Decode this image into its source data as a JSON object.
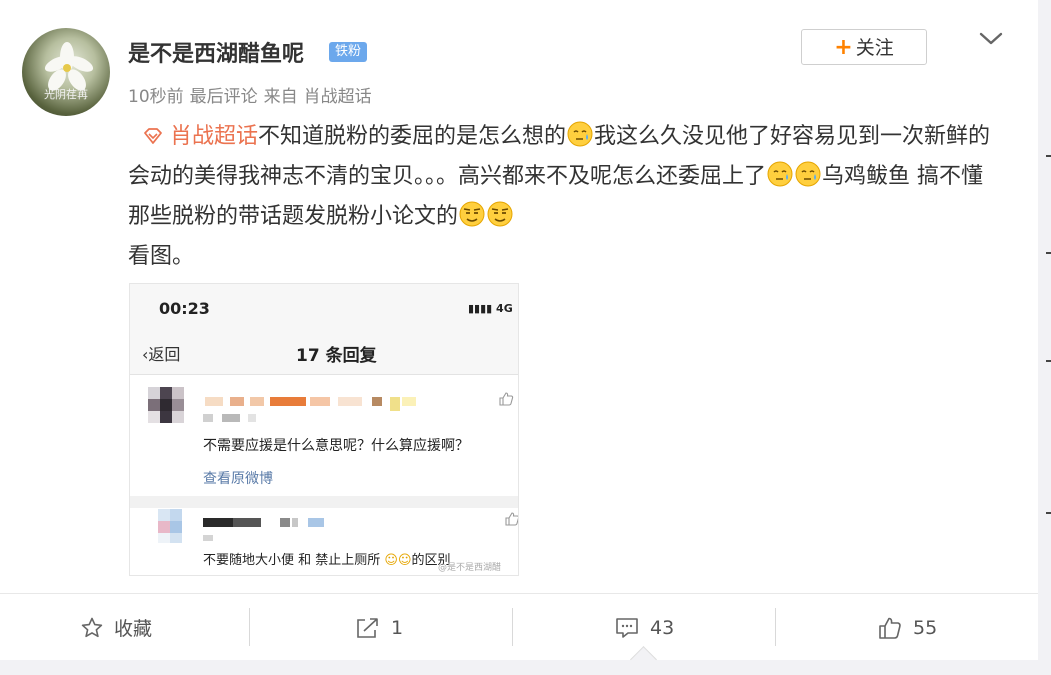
{
  "post": {
    "author": "是不是西湖醋鱼呢",
    "badge": "铁粉",
    "avatar_caption": "光阴荏苒",
    "meta": {
      "time": "10秒前",
      "last_comment": "最后评论",
      "from": "来自",
      "source": "肖战超话"
    },
    "follow_label": "关注",
    "topic_label": "肖战超话",
    "text_1": "不知道脱粉的委屈的是怎么想的",
    "text_2": "我这么久没见他了好容易见到一次新鲜的会动的美得我神志不清的宝贝。。。高兴都来不及呢怎么还委屈上了",
    "text_3": "乌鸡鲅鱼 搞不懂那些脱粉的带话题发脱粉小论文的",
    "text_4": "看图。"
  },
  "embedded_image": {
    "time": "00:23",
    "signal": "4G",
    "back_label": "返回",
    "title": "17 条回复",
    "comment_1": "不需要应援是什么意思呢？什么算应援啊？",
    "view_original": "查看原微博",
    "comment_2": "不要随地大小便 和 禁止上厕所",
    "comment_2_suffix": "的区别",
    "watermark": "@是不是西湖醋"
  },
  "actions": {
    "favorite_label": "收藏",
    "share_count": "1",
    "comment_count": "43",
    "like_count": "55"
  },
  "colors": {
    "topic": "#eb7350",
    "badge": "#6ca8ec",
    "follow_plus": "#ff8200"
  }
}
